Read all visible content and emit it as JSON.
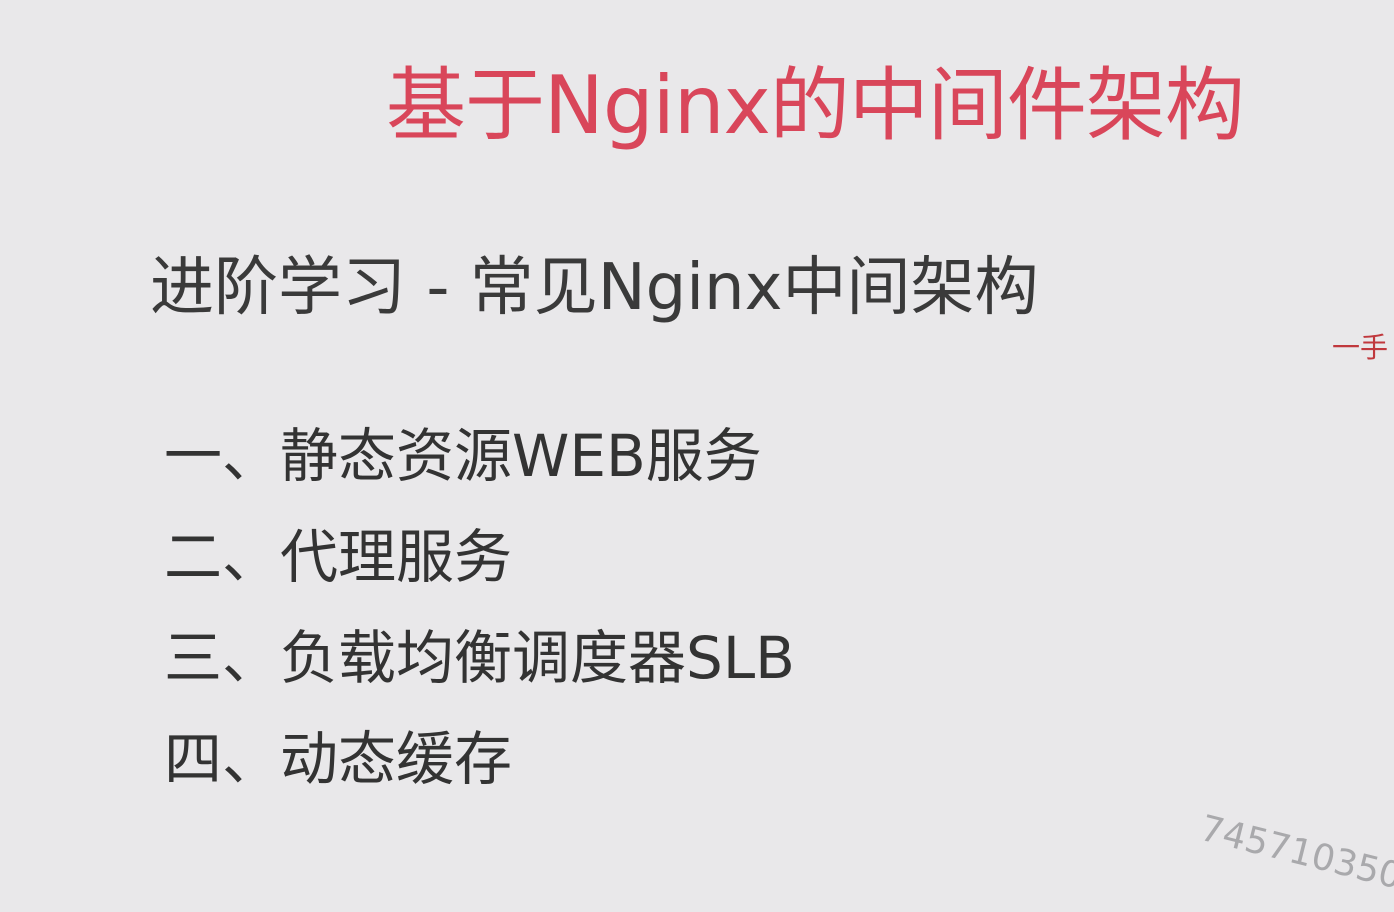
{
  "slide": {
    "title": "基于Nginx的中间件架构",
    "subtitle": "进阶学习 - 常见Nginx中间架构",
    "items": [
      "一、静态资源WEB服务",
      "二、代理服务",
      "三、负载均衡调度器SLB",
      "四、动态缓存"
    ]
  },
  "watermarks": {
    "corner_text": "一手",
    "number_text": "745710350"
  },
  "colors": {
    "background": "#e9e8ea",
    "title": "#d9465a",
    "body_text": "#333333",
    "watermark_red": "#c0383d",
    "watermark_gray": "#a9a9ac"
  }
}
